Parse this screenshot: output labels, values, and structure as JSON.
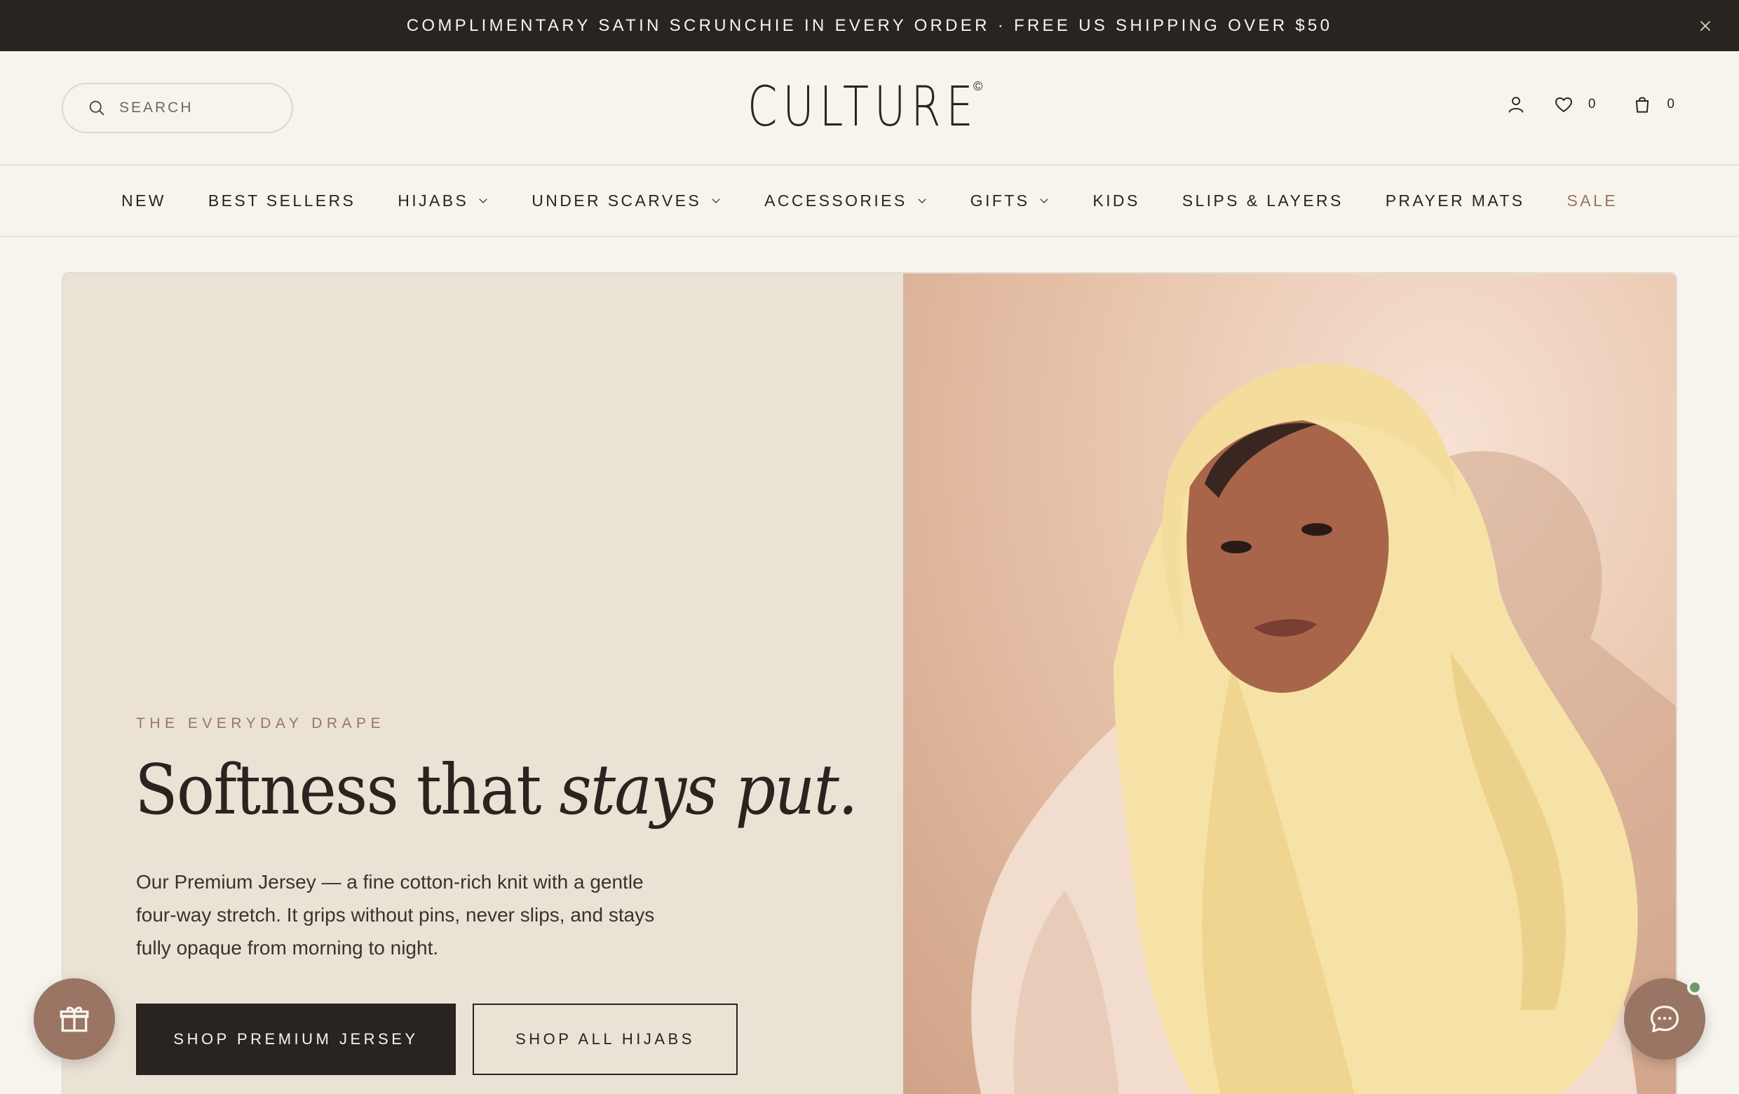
{
  "announcement": {
    "text": "COMPLIMENTARY SATIN SCRUNCHIE IN EVERY ORDER · FREE US SHIPPING OVER $50",
    "close_icon": "close-icon"
  },
  "header": {
    "search_placeholder": "SEARCH",
    "logo": "CULTURE",
    "logo_mark": "©",
    "wishlist_count": "0",
    "cart_count": "0"
  },
  "nav": {
    "items": [
      {
        "label": "NEW"
      },
      {
        "label": "BEST SELLERS"
      },
      {
        "label": "HIJABS"
      },
      {
        "label": "UNDER SCARVES"
      },
      {
        "label": "ACCESSORIES"
      },
      {
        "label": "GIFTS"
      },
      {
        "label": "KIDS"
      },
      {
        "label": "SLIPS & LAYERS"
      },
      {
        "label": "PRAYER MATS"
      },
      {
        "label": "SALE"
      }
    ]
  },
  "hero": {
    "eyebrow": "THE EVERYDAY DRAPE",
    "headline_regular": "Softness that ",
    "headline_italic": "stays put.",
    "body": "Our Premium Jersey — a fine cotton-rich knit with a gentle four-way stretch. It grips without pins, never slips, and stays fully opaque from morning to night.",
    "primary_cta": "SHOP PREMIUM JERSEY",
    "secondary_cta": "SHOP ALL HIJABS"
  },
  "colors": {
    "dark": "#2a2420",
    "cream": "#f7f4ee",
    "hero_panel": "#ebe2d6",
    "accent": "#9a7560",
    "online_dot": "#6f9a6a"
  }
}
